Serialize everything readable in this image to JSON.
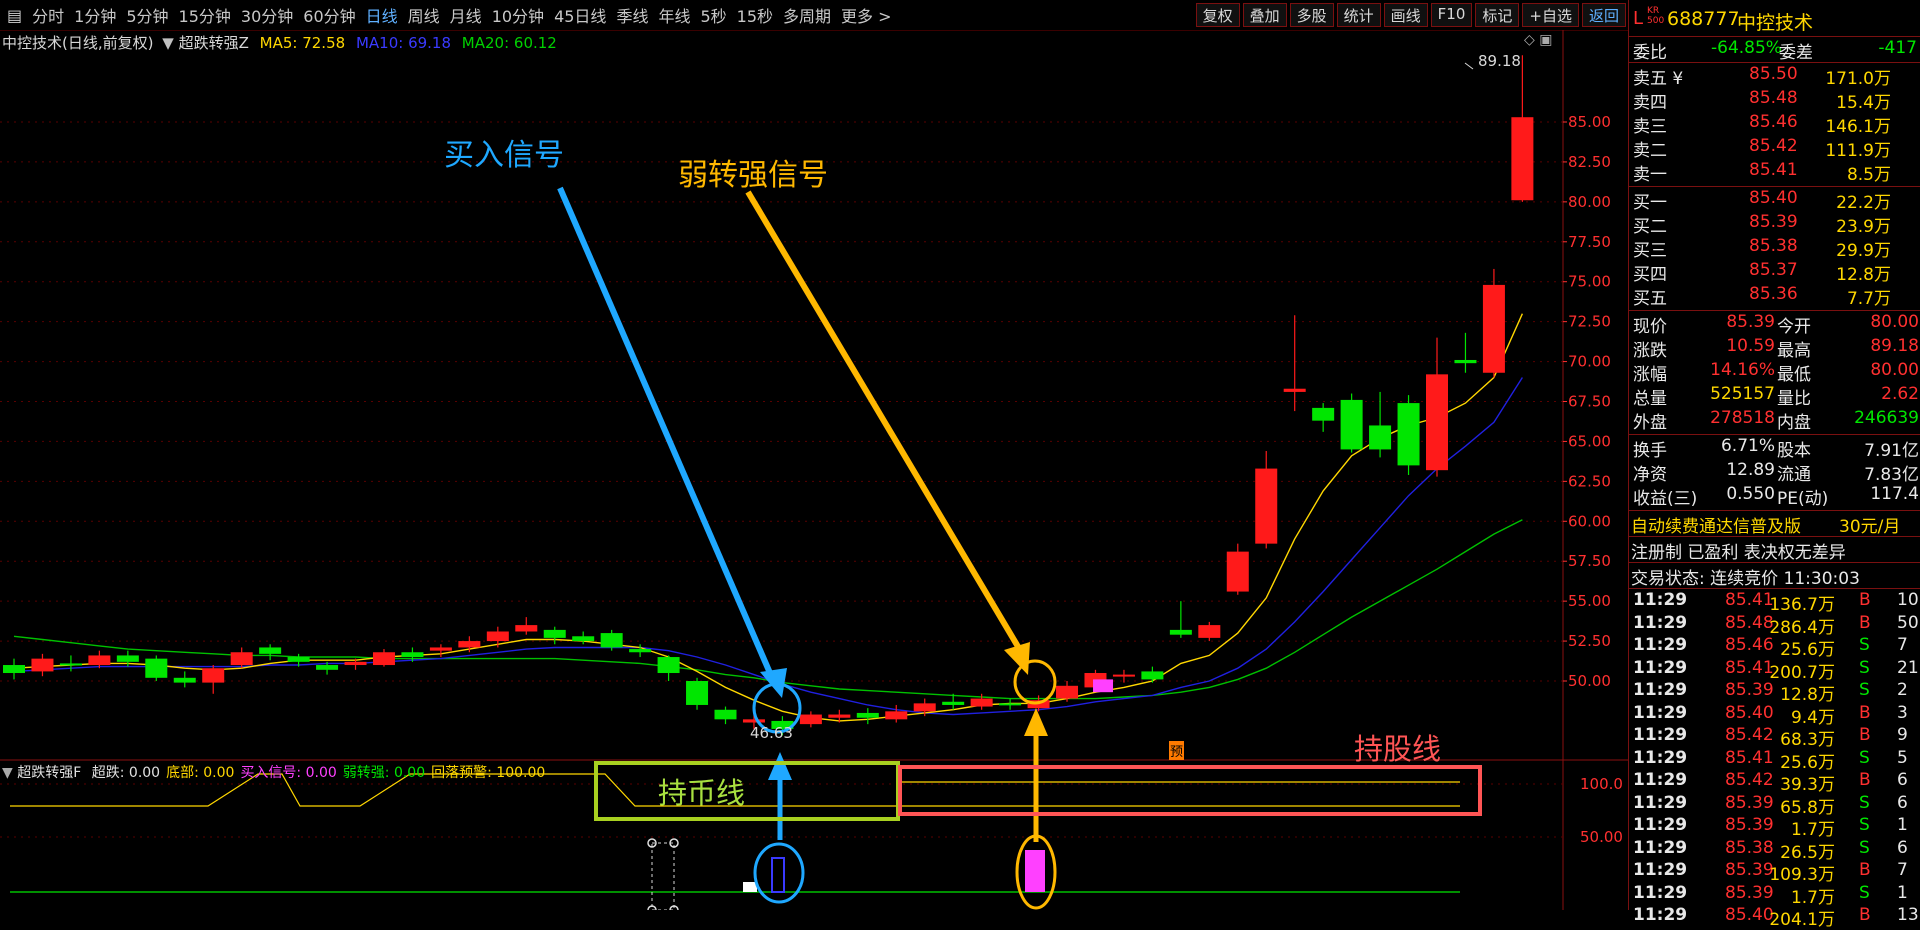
{
  "toolbar": {
    "periods": [
      "分时",
      "1分钟",
      "5分钟",
      "15分钟",
      "30分钟",
      "60分钟",
      "日线",
      "周线",
      "月线",
      "10分钟",
      "45日线",
      "季线",
      "年线",
      "5秒",
      "15秒",
      "多周期",
      "更多 >"
    ],
    "active_period": "日线",
    "right_buttons": [
      "复权",
      "叠加",
      "多股",
      "统计",
      "画线",
      "F10",
      "标记",
      "+自选",
      "返回"
    ]
  },
  "title_bar": {
    "stock": "中控技术(日线,前复权)",
    "indicator": "超跌转强Z",
    "ma5_label": "MA5: 72.58",
    "ma10_label": "MA10: 69.18",
    "ma20_label": "MA20: 60.12"
  },
  "price_axis": [
    "85.00",
    "82.50",
    "80.00",
    "77.50",
    "75.00",
    "72.50",
    "70.00",
    "67.50",
    "65.00",
    "62.50",
    "60.00",
    "57.50",
    "55.00",
    "52.50",
    "50.00"
  ],
  "high_label": "89.18",
  "low_label": "46.63",
  "annotations": {
    "buy_signal": "买入信号",
    "weak_to_strong": "弱转强信号",
    "hold_coin": "持币线",
    "hold_stock": "持股线",
    "pre_marker": "预"
  },
  "sub_indicator": {
    "name": "超跌转强F",
    "values": [
      {
        "label": "超跌: 0.00",
        "color": "#e0e0e0"
      },
      {
        "label": "底部: 0.00",
        "color": "#ffd700"
      },
      {
        "label": "买入信号: 0.00",
        "color": "#ff40ff"
      },
      {
        "label": "弱转强: 0.00",
        "color": "#00e600"
      },
      {
        "label": "回落预警: 100.00",
        "color": "#ffd700"
      }
    ],
    "axis": [
      "100.0",
      "50.00"
    ]
  },
  "quote": {
    "code_badge": "L",
    "badge_small": "KR 500",
    "code": "688777",
    "name": "中控技术",
    "weibi_label": "委比",
    "weibi": "-64.85%",
    "weicha_label": "委差",
    "weicha": "-417",
    "asks": [
      {
        "label": "卖五 ¥",
        "price": "85.50",
        "vol": "171.0万"
      },
      {
        "label": "卖四",
        "price": "85.48",
        "vol": "15.4万"
      },
      {
        "label": "卖三",
        "price": "85.46",
        "vol": "146.1万"
      },
      {
        "label": "卖二",
        "price": "85.42",
        "vol": "111.9万"
      },
      {
        "label": "卖一",
        "price": "85.41",
        "vol": "8.5万"
      }
    ],
    "bids": [
      {
        "label": "买一",
        "price": "85.40",
        "vol": "22.2万"
      },
      {
        "label": "买二",
        "price": "85.39",
        "vol": "23.9万"
      },
      {
        "label": "买三",
        "price": "85.38",
        "vol": "29.9万"
      },
      {
        "label": "买四",
        "price": "85.37",
        "vol": "12.8万"
      },
      {
        "label": "买五",
        "price": "85.36",
        "vol": "7.7万"
      }
    ],
    "stats": [
      {
        "l1": "现价",
        "v1": "85.39",
        "c1": "red",
        "l2": "今开",
        "v2": "80.00",
        "c2": "red"
      },
      {
        "l1": "涨跌",
        "v1": "10.59",
        "c1": "red",
        "l2": "最高",
        "v2": "89.18",
        "c2": "red"
      },
      {
        "l1": "涨幅",
        "v1": "14.16%",
        "c1": "red",
        "l2": "最低",
        "v2": "80.00",
        "c2": "red"
      },
      {
        "l1": "总量",
        "v1": "525157",
        "c1": "yellow",
        "l2": "量比",
        "v2": "2.62",
        "c2": "red"
      },
      {
        "l1": "外盘",
        "v1": "278518",
        "c1": "red",
        "l2": "内盘",
        "v2": "246639",
        "c2": "green"
      }
    ],
    "stats2": [
      {
        "l1": "换手",
        "v1": "6.71%",
        "l2": "股本",
        "v2": "7.91亿"
      },
      {
        "l1": "净资",
        "v1": "12.89",
        "l2": "流通",
        "v2": "7.83亿"
      },
      {
        "l1": "收益(三)",
        "v1": "0.550",
        "l2": "PE(动)",
        "v2": "117.4"
      }
    ],
    "ad_text": "自动续费通达信普及版",
    "ad_price": "30元/月",
    "notice": "注册制 已盈利 表决权无差异",
    "status": "交易状态: 连续竞价 11:30:03",
    "ticks": [
      {
        "t": "11:29",
        "p": "85.41",
        "v": "136.7万",
        "s": "B",
        "n": "10"
      },
      {
        "t": "11:29",
        "p": "85.48",
        "v": "286.4万",
        "s": "B",
        "n": "50"
      },
      {
        "t": "11:29",
        "p": "85.46",
        "v": "25.6万",
        "s": "S",
        "n": "7"
      },
      {
        "t": "11:29",
        "p": "85.41",
        "v": "200.7万",
        "s": "S",
        "n": "21"
      },
      {
        "t": "11:29",
        "p": "85.39",
        "v": "12.8万",
        "s": "S",
        "n": "2"
      },
      {
        "t": "11:29",
        "p": "85.40",
        "v": "9.4万",
        "s": "B",
        "n": "3"
      },
      {
        "t": "11:29",
        "p": "85.42",
        "v": "68.3万",
        "s": "B",
        "n": "9"
      },
      {
        "t": "11:29",
        "p": "85.41",
        "v": "25.6万",
        "s": "S",
        "n": "5"
      },
      {
        "t": "11:29",
        "p": "85.42",
        "v": "39.3万",
        "s": "B",
        "n": "6"
      },
      {
        "t": "11:29",
        "p": "85.39",
        "v": "65.8万",
        "s": "S",
        "n": "6"
      },
      {
        "t": "11:29",
        "p": "85.39",
        "v": "1.7万",
        "s": "S",
        "n": "1"
      },
      {
        "t": "11:29",
        "p": "85.38",
        "v": "26.5万",
        "s": "S",
        "n": "6"
      },
      {
        "t": "11:29",
        "p": "85.39",
        "v": "109.3万",
        "s": "B",
        "n": "7"
      },
      {
        "t": "11:29",
        "p": "85.39",
        "v": "1.7万",
        "s": "S",
        "n": "1"
      },
      {
        "t": "11:29",
        "p": "85.40",
        "v": "204.1万",
        "s": "B",
        "n": "13"
      }
    ]
  },
  "colors": {
    "up": "#ff1a1a",
    "down": "#00e600",
    "ma5": "#ffd700",
    "ma10": "#2020e0",
    "ma20": "#00c000",
    "buy_annot": "#1fa8ff",
    "weak_annot": "#ffb800"
  },
  "candles": [
    {
      "o": 51.0,
      "c": 50.5,
      "h": 51.4,
      "l": 50.1
    },
    {
      "o": 50.6,
      "c": 51.4,
      "h": 51.7,
      "l": 50.3
    },
    {
      "o": 51.1,
      "c": 51.0,
      "h": 51.6,
      "l": 50.6
    },
    {
      "o": 51.0,
      "c": 51.6,
      "h": 51.9,
      "l": 50.8
    },
    {
      "o": 51.6,
      "c": 51.2,
      "h": 51.9,
      "l": 50.9
    },
    {
      "o": 51.4,
      "c": 50.2,
      "h": 51.6,
      "l": 50.0
    },
    {
      "o": 50.2,
      "c": 49.9,
      "h": 50.6,
      "l": 49.6
    },
    {
      "o": 49.9,
      "c": 50.8,
      "h": 51.0,
      "l": 49.2
    },
    {
      "o": 51.0,
      "c": 51.8,
      "h": 52.1,
      "l": 50.8
    },
    {
      "o": 52.1,
      "c": 51.7,
      "h": 52.3,
      "l": 51.3
    },
    {
      "o": 51.5,
      "c": 51.2,
      "h": 51.7,
      "l": 50.9
    },
    {
      "o": 51.0,
      "c": 50.7,
      "h": 51.2,
      "l": 50.4
    },
    {
      "o": 51.0,
      "c": 51.2,
      "h": 51.4,
      "l": 50.7
    },
    {
      "o": 51.0,
      "c": 51.8,
      "h": 52.0,
      "l": 50.9
    },
    {
      "o": 51.8,
      "c": 51.5,
      "h": 52.1,
      "l": 51.2
    },
    {
      "o": 51.9,
      "c": 52.1,
      "h": 52.3,
      "l": 51.5
    },
    {
      "o": 52.1,
      "c": 52.5,
      "h": 52.8,
      "l": 51.8
    },
    {
      "o": 52.5,
      "c": 53.1,
      "h": 53.4,
      "l": 52.1
    },
    {
      "o": 53.1,
      "c": 53.5,
      "h": 54.0,
      "l": 52.9
    },
    {
      "o": 53.2,
      "c": 52.7,
      "h": 53.4,
      "l": 52.3
    },
    {
      "o": 52.8,
      "c": 52.5,
      "h": 53.1,
      "l": 52.3
    },
    {
      "o": 53.0,
      "c": 52.1,
      "h": 53.2,
      "l": 51.9
    },
    {
      "o": 52.0,
      "c": 51.8,
      "h": 52.3,
      "l": 51.5
    },
    {
      "o": 51.5,
      "c": 50.5,
      "h": 51.6,
      "l": 50.0
    },
    {
      "o": 50.0,
      "c": 48.5,
      "h": 50.2,
      "l": 48.2
    },
    {
      "o": 48.2,
      "c": 47.6,
      "h": 48.4,
      "l": 47.3
    },
    {
      "o": 47.4,
      "c": 47.6,
      "h": 47.9,
      "l": 47.0
    },
    {
      "o": 47.5,
      "c": 47.0,
      "h": 47.8,
      "l": 46.6
    },
    {
      "o": 47.3,
      "c": 47.9,
      "h": 48.1,
      "l": 47.1
    },
    {
      "o": 47.7,
      "c": 47.9,
      "h": 48.2,
      "l": 47.4
    },
    {
      "o": 48.0,
      "c": 47.7,
      "h": 48.3,
      "l": 47.3
    },
    {
      "o": 47.6,
      "c": 48.1,
      "h": 48.5,
      "l": 47.4
    },
    {
      "o": 48.1,
      "c": 48.6,
      "h": 48.9,
      "l": 47.8
    },
    {
      "o": 48.7,
      "c": 48.5,
      "h": 49.2,
      "l": 48.2
    },
    {
      "o": 48.4,
      "c": 48.9,
      "h": 49.2,
      "l": 48.2
    },
    {
      "o": 48.6,
      "c": 48.5,
      "h": 48.9,
      "l": 48.2
    },
    {
      "o": 48.3,
      "c": 48.8,
      "h": 49.1,
      "l": 48.1
    },
    {
      "o": 48.9,
      "c": 49.7,
      "h": 50.0,
      "l": 48.7
    },
    {
      "o": 49.6,
      "c": 50.5,
      "h": 50.7,
      "l": 49.4
    },
    {
      "o": 50.3,
      "c": 50.4,
      "h": 50.7,
      "l": 49.9
    },
    {
      "o": 50.6,
      "c": 50.1,
      "h": 50.9,
      "l": 49.9
    },
    {
      "o": 53.2,
      "c": 52.9,
      "h": 55.0,
      "l": 52.7
    },
    {
      "o": 52.7,
      "c": 53.5,
      "h": 53.7,
      "l": 52.5
    },
    {
      "o": 55.6,
      "c": 58.1,
      "h": 58.6,
      "l": 55.4
    },
    {
      "o": 58.6,
      "c": 63.3,
      "h": 64.4,
      "l": 58.3
    },
    {
      "o": 68.1,
      "c": 68.3,
      "h": 72.9,
      "l": 66.9
    },
    {
      "o": 67.1,
      "c": 66.3,
      "h": 67.4,
      "l": 65.6
    },
    {
      "o": 67.6,
      "c": 64.5,
      "h": 68.0,
      "l": 64.3
    },
    {
      "o": 66.0,
      "c": 64.5,
      "h": 68.1,
      "l": 64.0
    },
    {
      "o": 67.4,
      "c": 63.5,
      "h": 67.9,
      "l": 62.9
    },
    {
      "o": 63.2,
      "c": 69.2,
      "h": 71.5,
      "l": 62.8
    },
    {
      "o": 70.1,
      "c": 69.9,
      "h": 71.8,
      "l": 69.3
    },
    {
      "o": 69.3,
      "c": 74.8,
      "h": 75.8,
      "l": 69.0
    },
    {
      "o": 80.1,
      "c": 85.3,
      "h": 89.18,
      "l": 80.0
    }
  ],
  "ma5": [
    50.8,
    50.9,
    51.0,
    51.1,
    51.1,
    51.0,
    50.8,
    50.7,
    50.8,
    51.1,
    51.3,
    51.3,
    51.3,
    51.5,
    51.6,
    51.7,
    52.0,
    52.3,
    52.6,
    52.6,
    52.5,
    52.3,
    52.1,
    51.5,
    50.6,
    49.6,
    48.8,
    48.1,
    47.7,
    47.5,
    47.6,
    47.8,
    48.0,
    48.2,
    48.5,
    48.6,
    48.6,
    48.9,
    49.3,
    49.6,
    50.0,
    51.1,
    51.6,
    53.0,
    55.2,
    58.9,
    61.9,
    64.1,
    65.2,
    66.0,
    66.5,
    67.4,
    69.0,
    73.0
  ],
  "ma10": [
    50.6,
    50.7,
    50.8,
    50.9,
    50.9,
    50.9,
    50.9,
    50.9,
    50.9,
    51.0,
    51.0,
    51.1,
    51.1,
    51.2,
    51.3,
    51.4,
    51.6,
    51.8,
    52.0,
    52.1,
    52.1,
    52.1,
    52.1,
    51.9,
    51.5,
    51.0,
    50.4,
    49.8,
    49.3,
    48.9,
    48.5,
    48.2,
    48.0,
    47.9,
    48.0,
    48.1,
    48.2,
    48.4,
    48.7,
    48.9,
    49.1,
    49.6,
    50.0,
    50.8,
    52.0,
    53.7,
    55.6,
    57.6,
    59.6,
    61.6,
    63.3,
    64.7,
    66.2,
    69.0
  ],
  "ma20": [
    52.8,
    52.6,
    52.4,
    52.2,
    52.0,
    51.9,
    51.8,
    51.7,
    51.6,
    51.6,
    51.5,
    51.5,
    51.5,
    51.4,
    51.4,
    51.4,
    51.4,
    51.4,
    51.4,
    51.4,
    51.3,
    51.2,
    51.1,
    50.9,
    50.7,
    50.4,
    50.2,
    49.9,
    49.7,
    49.5,
    49.4,
    49.3,
    49.2,
    49.1,
    49.0,
    48.9,
    48.9,
    48.9,
    48.9,
    49.0,
    49.1,
    49.3,
    49.6,
    50.1,
    50.8,
    51.8,
    52.9,
    54.0,
    55.0,
    56.0,
    57.0,
    58.1,
    59.2,
    60.1
  ]
}
